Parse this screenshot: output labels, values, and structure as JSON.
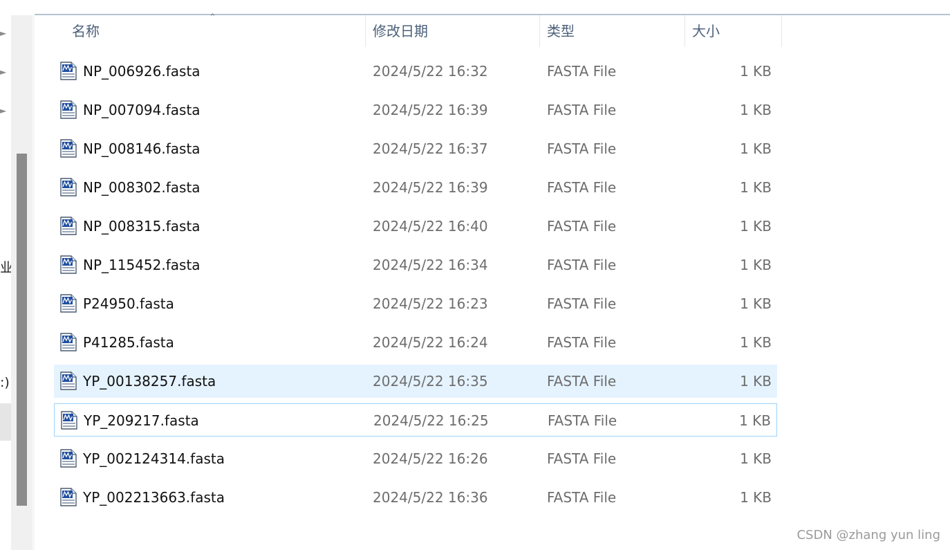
{
  "nav": {
    "partial_labels": [
      "业",
      ":)"
    ]
  },
  "columns": {
    "name": "名称",
    "modified": "修改日期",
    "type": "类型",
    "size": "大小"
  },
  "files": [
    {
      "name": "NP_006926.fasta",
      "modified": "2024/5/22 16:32",
      "type": "FASTA File",
      "size": "1 KB"
    },
    {
      "name": "NP_007094.fasta",
      "modified": "2024/5/22 16:39",
      "type": "FASTA File",
      "size": "1 KB"
    },
    {
      "name": "NP_008146.fasta",
      "modified": "2024/5/22 16:37",
      "type": "FASTA File",
      "size": "1 KB"
    },
    {
      "name": "NP_008302.fasta",
      "modified": "2024/5/22 16:39",
      "type": "FASTA File",
      "size": "1 KB"
    },
    {
      "name": "NP_008315.fasta",
      "modified": "2024/5/22 16:40",
      "type": "FASTA File",
      "size": "1 KB"
    },
    {
      "name": "NP_115452.fasta",
      "modified": "2024/5/22 16:34",
      "type": "FASTA File",
      "size": "1 KB"
    },
    {
      "name": "P24950.fasta",
      "modified": "2024/5/22 16:23",
      "type": "FASTA File",
      "size": "1 KB"
    },
    {
      "name": "P41285.fasta",
      "modified": "2024/5/22 16:24",
      "type": "FASTA File",
      "size": "1 KB"
    },
    {
      "name": "YP_00138257.fasta",
      "modified": "2024/5/22 16:35",
      "type": "FASTA File",
      "size": "1 KB"
    },
    {
      "name": "YP_209217.fasta",
      "modified": "2024/5/22 16:25",
      "type": "FASTA File",
      "size": "1 KB"
    },
    {
      "name": "YP_002124314.fasta",
      "modified": "2024/5/22 16:26",
      "type": "FASTA File",
      "size": "1 KB"
    },
    {
      "name": "YP_002213663.fasta",
      "modified": "2024/5/22 16:36",
      "type": "FASTA File",
      "size": "1 KB"
    }
  ],
  "state": {
    "hovered_row": 8,
    "focused_row": 9,
    "sort_column": "name",
    "file_icon": "fasta-file-icon"
  },
  "colors": {
    "hover_bg": "#e5f3ff",
    "focus_border": "#99d1ff",
    "header_text": "#4c607a"
  },
  "watermark": "CSDN @zhang yun ling"
}
